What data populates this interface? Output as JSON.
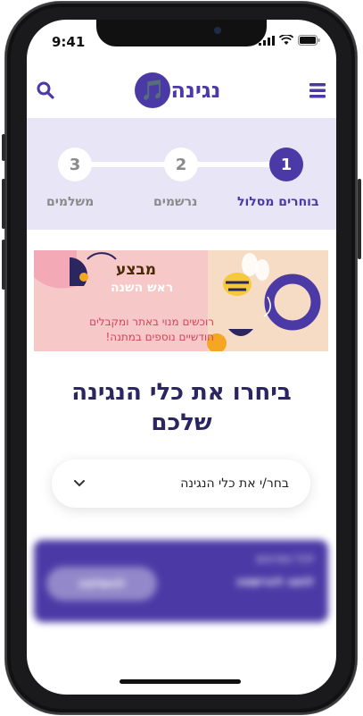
{
  "status_bar": {
    "time": "9:41"
  },
  "header": {
    "logo_text": "נגינה",
    "logo_mark": "🎵",
    "menu_icon": "hamburger-icon",
    "search_icon": "search-icon"
  },
  "stepper": {
    "steps": [
      {
        "number": "1",
        "label": "בוחרים מסלול",
        "state": "active"
      },
      {
        "number": "2",
        "label": "נרשמים",
        "state": "inactive"
      },
      {
        "number": "3",
        "label": "משלמים",
        "state": "inactive"
      }
    ]
  },
  "banner": {
    "title": "מבצע",
    "subtitle": "ראש השנה",
    "line1": "רוכשים מנוי באתר ומקבלים",
    "line2": "חודשיים נוספים במתנה!"
  },
  "main": {
    "heading_line1": "ביחרו את כלי הנגינה",
    "heading_line2": "שלכם",
    "select_placeholder": "בחר/י את כלי הנגינה"
  },
  "cta": {
    "line1": "לכל הפרטים",
    "line2": "לחצו להרשמה",
    "button_label": "להשלמה"
  },
  "colors": {
    "brand": "#4b3aa6",
    "stepper_bg": "#e7e5f6",
    "heading": "#2b2560",
    "banner_bg": "#f7c8c8"
  }
}
